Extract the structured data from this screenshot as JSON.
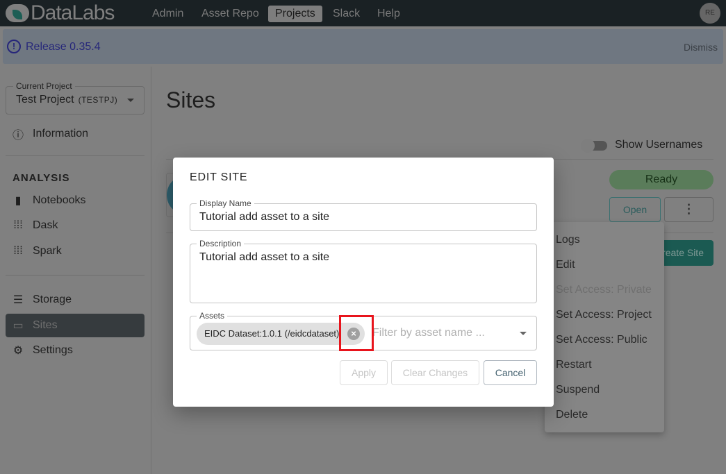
{
  "nav": {
    "logo": "DataLabs",
    "items": [
      "Admin",
      "Asset Repo",
      "Projects",
      "Slack",
      "Help"
    ],
    "active": "Projects",
    "avatar": "RE"
  },
  "banner": {
    "text": "Release 0.35.4",
    "dismiss": "Dismiss"
  },
  "sidebar": {
    "project_label": "Current Project",
    "project_name": "Test Project",
    "project_code": "(TESTPJ)",
    "information": "Information",
    "section": "ANALYSIS",
    "items": [
      "Notebooks",
      "Dask",
      "Spark",
      "Storage",
      "Sites",
      "Settings"
    ],
    "active": "Sites"
  },
  "main": {
    "title": "Sites",
    "toggle_label": "Show Usernames",
    "status": "Ready",
    "open": "Open",
    "create": "Create Site"
  },
  "menu": {
    "items": [
      {
        "label": "Logs"
      },
      {
        "label": "Edit"
      },
      {
        "label": "Set Access: Private",
        "disabled": true
      },
      {
        "label": "Set Access: Project"
      },
      {
        "label": "Set Access: Public"
      },
      {
        "label": "Restart"
      },
      {
        "label": "Suspend"
      },
      {
        "label": "Delete"
      }
    ]
  },
  "dialog": {
    "title": "EDIT SITE",
    "display_name_label": "Display Name",
    "display_name": "Tutorial add asset to a site",
    "description_label": "Description",
    "description": "Tutorial add asset to a site",
    "assets_label": "Assets",
    "asset_chip": "EIDC Dataset:1.0.1 (/eidcdataset)",
    "assets_placeholder": "Filter by asset name ...",
    "apply": "Apply",
    "clear": "Clear Changes",
    "cancel": "Cancel"
  }
}
